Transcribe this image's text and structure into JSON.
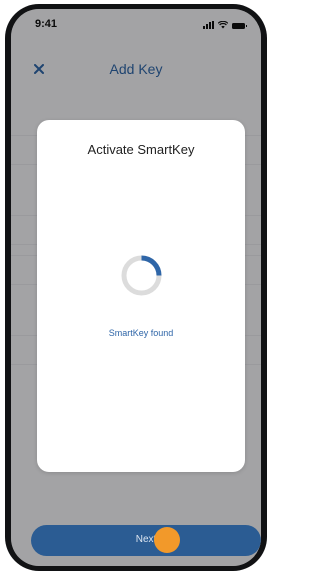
{
  "status_bar": {
    "time": "9:41",
    "icons": [
      "signal-icon",
      "wifi-icon",
      "battery-icon"
    ]
  },
  "nav": {
    "close_icon": "close-icon",
    "title": "Add Key"
  },
  "modal": {
    "title": "Activate SmartKey",
    "spinner_icon": "loading-spinner-icon",
    "spinner_progress": 0.25,
    "status_text": "SmartKey found"
  },
  "footer": {
    "next_label": "Next"
  },
  "colors": {
    "accent": "#2f66a8",
    "button": "#2b5c93",
    "touch_indicator": "#f2992a",
    "spinner_track": "#dcdcdc"
  }
}
